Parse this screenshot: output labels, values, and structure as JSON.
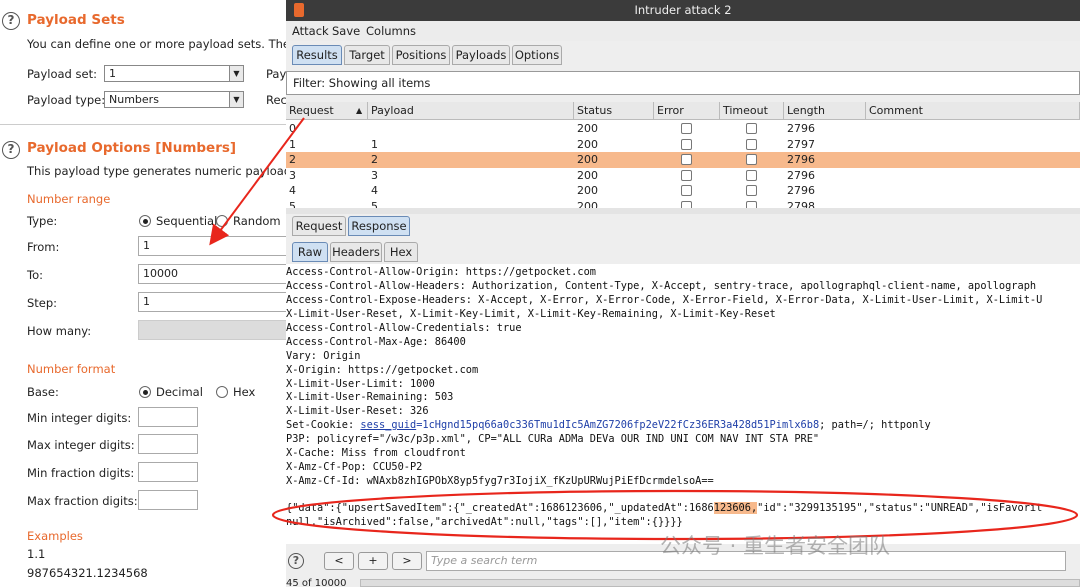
{
  "left": {
    "sets": {
      "title": "Payload Sets",
      "desc": "You can define one or more payload sets. The nu",
      "set_label": "Payload set:",
      "set_value": "1",
      "type_label": "Payload type:",
      "type_value": "Numbers",
      "right1": "Pay",
      "right2": "Rec"
    },
    "options": {
      "title": "Payload Options [Numbers]",
      "desc": "This payload type generates numeric payloads wit",
      "range_title": "Number range",
      "type_label": "Type:",
      "sequential": "Sequential",
      "random": "Random",
      "from_label": "From:",
      "from_value": "1",
      "to_label": "To:",
      "to_value": "10000",
      "step_label": "Step:",
      "step_value": "1",
      "howmany_label": "How many:",
      "format_title": "Number format",
      "base_label": "Base:",
      "decimal": "Decimal",
      "hex": "Hex",
      "min_int": "Min integer digits:",
      "max_int": "Max integer digits:",
      "min_frac": "Min fraction digits:",
      "max_frac": "Max fraction digits:",
      "examples_title": "Examples",
      "example1": "1.1",
      "example2": "987654321.1234568"
    }
  },
  "window": {
    "title": "Intruder attack 2",
    "menu": [
      "Attack",
      "Save",
      "Columns"
    ],
    "tabs": [
      "Results",
      "Target",
      "Positions",
      "Payloads",
      "Options"
    ],
    "filter": "Filter: Showing all items",
    "columns": [
      "Request",
      "Payload",
      "Status",
      "Error",
      "Timeout",
      "Length",
      "Comment"
    ],
    "rows": [
      {
        "request": "0",
        "payload": "",
        "status": "200",
        "length": "2796"
      },
      {
        "request": "1",
        "payload": "1",
        "status": "200",
        "length": "2797"
      },
      {
        "request": "2",
        "payload": "2",
        "status": "200",
        "length": "2796"
      },
      {
        "request": "3",
        "payload": "3",
        "status": "200",
        "length": "2796"
      },
      {
        "request": "4",
        "payload": "4",
        "status": "200",
        "length": "2796"
      },
      {
        "request": "5",
        "payload": "5",
        "status": "200",
        "length": "2798"
      }
    ],
    "rr_tabs": [
      "Request",
      "Response"
    ],
    "view_tabs": [
      "Raw",
      "Headers",
      "Hex"
    ],
    "lines": [
      "Access-Control-Allow-Origin: https://getpocket.com",
      "Access-Control-Allow-Headers: Authorization, Content-Type, X-Accept, sentry-trace, apollographql-client-name, apollograph",
      "Access-Control-Expose-Headers: X-Accept, X-Error, X-Error-Code, X-Error-Field, X-Error-Data, X-Limit-User-Limit, X-Limit-U",
      "X-Limit-User-Reset, X-Limit-Key-Limit, X-Limit-Key-Remaining, X-Limit-Key-Reset",
      "Access-Control-Allow-Credentials: true",
      "Access-Control-Max-Age: 86400",
      "Vary: Origin",
      "X-Origin: https://getpocket.com",
      "X-Limit-User-Limit: 1000",
      "X-Limit-User-Remaining: 503",
      "X-Limit-User-Reset: 326"
    ],
    "cookie": {
      "prefix": "Set-Cookie: ",
      "name": "sess_guid",
      "value": "=1cHgnd15pq66a0c336Tmu1dIc5AmZG7206fp2eV22fCz36ER3a428d51Pimlx6b8",
      "rest": "; path=/; httponly"
    },
    "lines2": [
      "P3P: policyref=\"/w3c/p3p.xml\", CP=\"ALL CURa ADMa DEVa OUR IND UNI COM NAV INT STA PRE\"",
      "X-Cache: Miss from cloudfront",
      "X-Amz-Cf-Pop: CCU50-P2",
      "X-Amz-Cf-Id: wNAxb8zhIGPObX8yp5fyg7r3IojiX_fKzUpURWujPiEfDcrmdelsoA=="
    ],
    "json1_a": "{\"data\":{\"upsertSavedItem\":{\"_createdAt\":1686123606,\"_updatedAt\":1686",
    "json1_hl": "123606,",
    "json1_b": "\"id\":\"3299135195\",\"status\":\"UNREAD\",\"isFavorit",
    "json2": "null,\"isArchived\":false,\"archivedAt\":null,\"tags\":[],\"item\":{}}}}",
    "help": "?",
    "prev": "<",
    "add": "+",
    "next": ">",
    "search_placeholder": "Type a search term",
    "progress": "45 of 10000"
  },
  "watermark": "公众号 · 重生者安全团队",
  "colors": {
    "accent": "#e8692d",
    "annotation": "#e8261c",
    "selected_row": "#f7b98c"
  }
}
